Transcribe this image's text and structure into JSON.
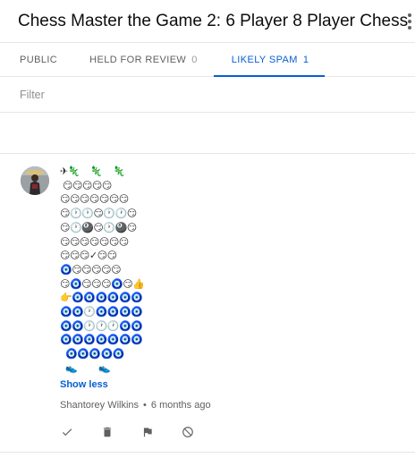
{
  "header": {
    "title": "Chess Master the Game 2: 6 Player 8 Player Chess"
  },
  "tabs": [
    {
      "label": "PUBLIC",
      "count": ""
    },
    {
      "label": "HELD FOR REVIEW",
      "count": "0"
    },
    {
      "label": "LIKELY SPAM",
      "count": "1",
      "active": true
    }
  ],
  "filter": {
    "placeholder": "Filter"
  },
  "comment": {
    "lines": [
      "✈🦎    🦎    🦎",
      " 😏😏😏😏😏",
      "😏😏😏😏😏😏😏",
      "😏🕐🕐😏🕐🕐😏",
      "😏🕐🎱😏🕐🎱😏",
      "😏😏😏😏😏😏😏",
      "😏😏😏✓😏😏",
      "🧿😏😏😏😏😏",
      "😏🧿😏😏😏🧿😏👍",
      "👉🧿🧿🧿🧿🧿🧿",
      "🧿🧿🕐🧿🧿🧿🧿",
      "🧿🧿🕐🕐🕐🧿🧿",
      "🧿🧿🧿🧿🧿🧿🧿",
      "  🧿🧿🧿🧿🧿",
      "  👟        👟"
    ],
    "show_less_label": "Show less",
    "author": "Shantorey Wilkins",
    "separator": "•",
    "time": "6 months ago"
  },
  "colors": {
    "accent": "#065fd4",
    "text_secondary": "#606060",
    "divider": "#e6e6e6"
  },
  "icons": {
    "more": "more-vert-icon",
    "approve": "checkmark-icon",
    "delete": "trash-icon",
    "report": "flag-icon",
    "block": "block-icon"
  }
}
